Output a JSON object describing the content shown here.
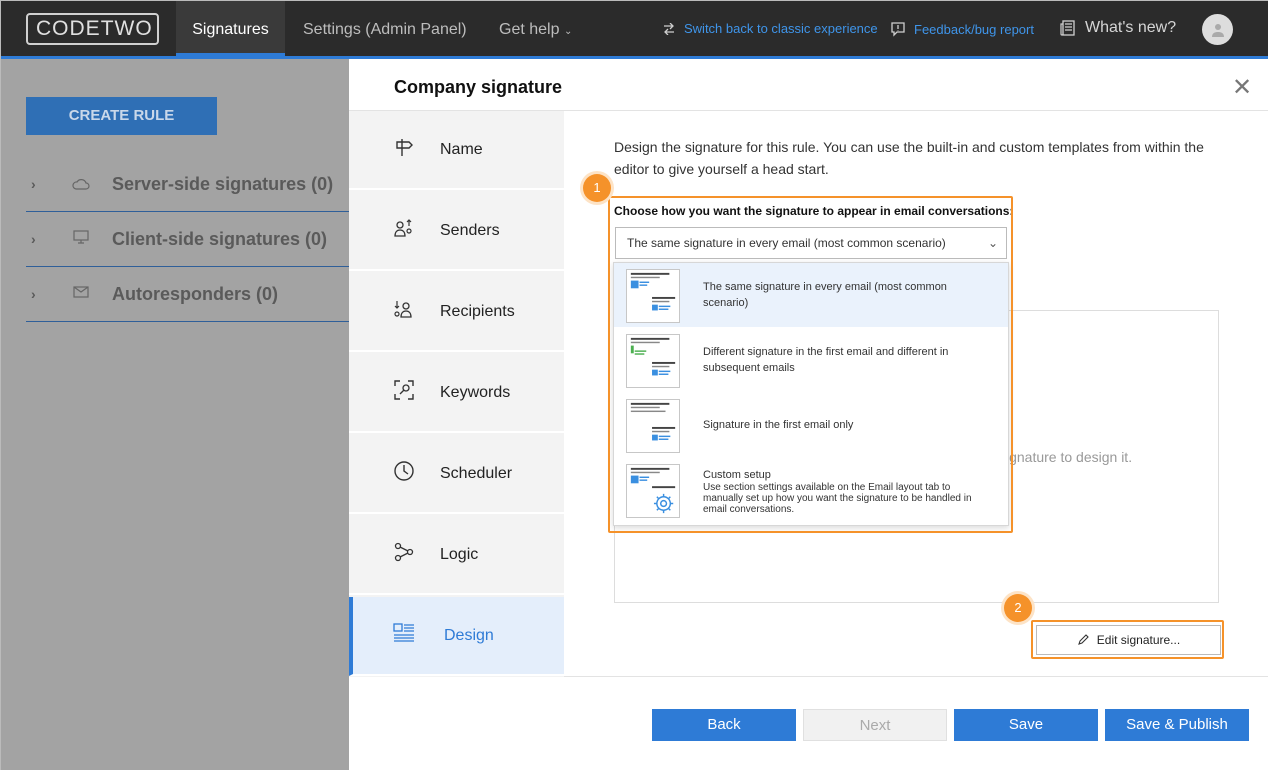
{
  "header": {
    "logo_left": "CODE",
    "logo_right": "TWO",
    "tabs": [
      {
        "label": "Signatures"
      },
      {
        "label": "Settings (Admin Panel)"
      },
      {
        "label": "Get help"
      }
    ],
    "switch_link": "Switch back to classic experience",
    "feedback_link": "Feedback/bug report",
    "whats_new": "What's new?"
  },
  "background": {
    "create_rule": "CREATE RULE",
    "groups": [
      {
        "label": "Server-side signatures (0)"
      },
      {
        "label": "Client-side signatures (0)"
      },
      {
        "label": "Autoresponders (0)"
      }
    ]
  },
  "modal": {
    "title": "Company signature",
    "close": "✕",
    "steps": [
      {
        "label": "Name"
      },
      {
        "label": "Senders"
      },
      {
        "label": "Recipients"
      },
      {
        "label": "Keywords"
      },
      {
        "label": "Scheduler"
      },
      {
        "label": "Logic"
      },
      {
        "label": "Design"
      }
    ],
    "intro": "Design the signature for this rule. You can use the built-in and custom templates from within the editor to give yourself a head start.",
    "dropdown": {
      "label": "Choose how you want the signature to appear in email conversations:",
      "selected": "The same signature in every email (most common scenario)",
      "options": [
        {
          "text": "The same signature in every email (most common scenario)"
        },
        {
          "text": "Different signature in the first email and different in subsequent emails"
        },
        {
          "text": "Signature in the first email only"
        },
        {
          "title": "Custom setup",
          "text": "Use section settings available on the Email layout tab to manually set up how you want the signature to be handled in email conversations."
        }
      ]
    },
    "preview_hint": "ignature to design it.",
    "edit_button": "Edit signature...",
    "badges": [
      "1",
      "2"
    ],
    "buttons": {
      "back": "Back",
      "next": "Next",
      "save": "Save",
      "save_publish": "Save & Publish"
    }
  },
  "colors": {
    "accent": "#2e7bd6",
    "highlight": "#f5922a",
    "topbar": "#2b2b2b"
  }
}
